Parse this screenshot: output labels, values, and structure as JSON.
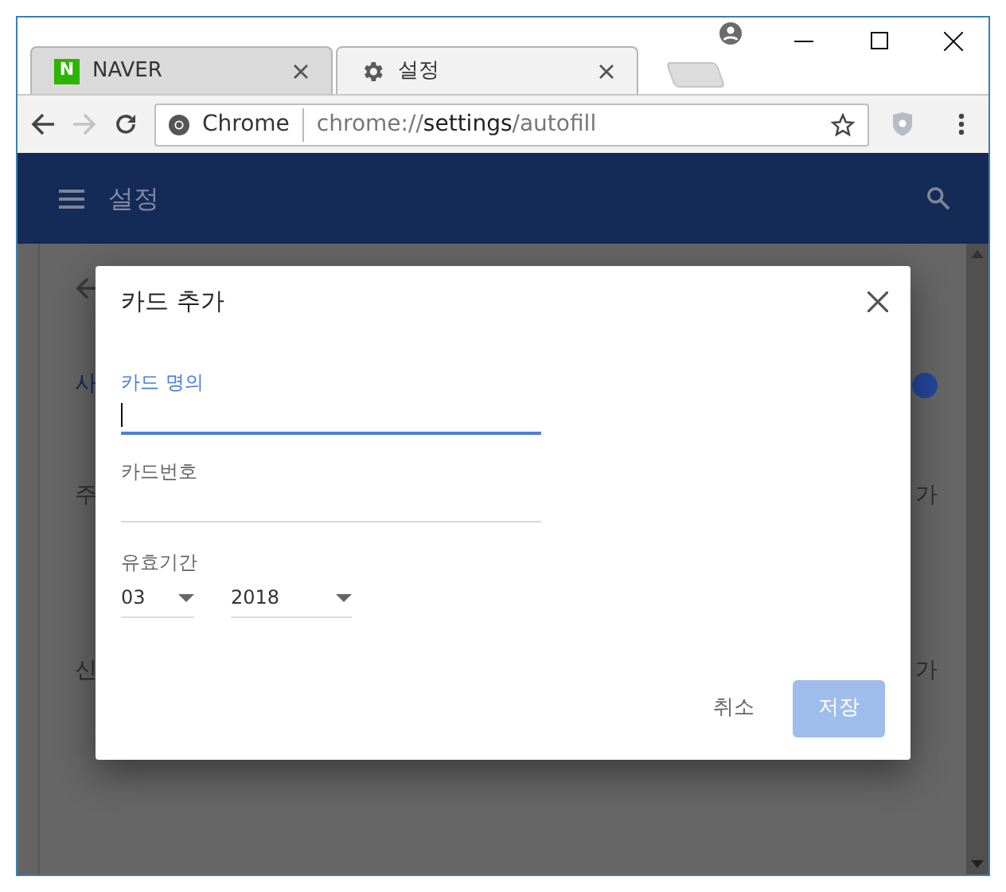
{
  "tabs": [
    {
      "title": "NAVER",
      "selected": false,
      "kind": "naver",
      "icon_text": "N"
    },
    {
      "title": "설정",
      "selected": true,
      "kind": "gear"
    }
  ],
  "address_bar": {
    "site_label": "Chrome",
    "url_scheme": "chrome://",
    "url_host": "settings",
    "url_path": "/autofill"
  },
  "header": {
    "title": "설정"
  },
  "background_rows": [
    {
      "kind": "toggle",
      "label": "사",
      "on": true
    },
    {
      "kind": "link",
      "label": "주",
      "trailing": "가"
    },
    {
      "kind": "link",
      "label": "신",
      "trailing": "가"
    }
  ],
  "dialog": {
    "title": "카드 추가",
    "fields": [
      {
        "label": "카드 명의",
        "focused": true
      },
      {
        "label": "카드번호",
        "focused": false
      }
    ],
    "expiration": {
      "label": "유효기간",
      "selects": [
        "03",
        "2018"
      ]
    },
    "cancel_button": {
      "label": "취소"
    },
    "save_button": {
      "label": "저장",
      "disabled": true
    }
  }
}
